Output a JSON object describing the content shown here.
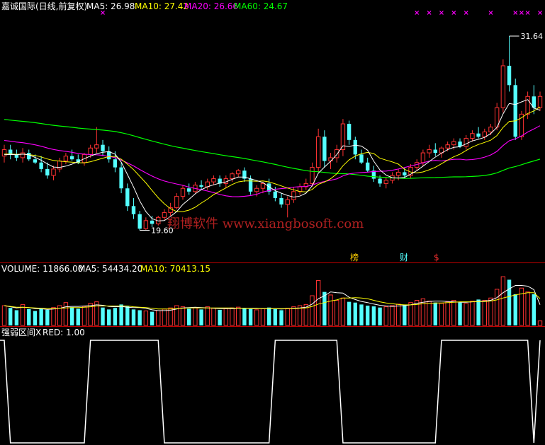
{
  "main_header": {
    "title": "嘉诚国际(日线,前复权)",
    "ma5": "MA5: 26.98",
    "ma10": "MA10: 27.42",
    "ma20": "MA20: 26.66",
    "ma60": "MA60: 24.67"
  },
  "volume_header": {
    "volume": "VOLUME: 11866.00",
    "ma5": "MA5: 54434.20",
    "ma10": "MA10: 70413.15"
  },
  "indicator_header": {
    "label": "强弱区间X",
    "red": "RED: 1.00"
  },
  "markers": {
    "bang": "榜",
    "cai": "财",
    "dollar": "$"
  },
  "watermark": "翔博软件 www.xiangbosoft.com",
  "colors": {
    "background": "#000000",
    "up": "#ff3232",
    "down": "#54ffff",
    "ma5": "#ffffff",
    "ma10": "#ffff00",
    "ma20": "#ff00ff",
    "ma60": "#00ff00",
    "separator": "#c00000",
    "signal_marks": "#ff00ff"
  },
  "chart_data": [
    {
      "type": "candlestick",
      "ylim": [
        18.0,
        33.0
      ],
      "annotations": [
        {
          "text": "31.64",
          "label": "high"
        },
        {
          "text": "19.60",
          "label": "low"
        }
      ],
      "candles": [
        [
          24.2,
          24.9,
          23.8,
          24.6
        ],
        [
          24.6,
          24.9,
          24.0,
          24.3
        ],
        [
          24.3,
          24.6,
          23.9,
          24.1
        ],
        [
          24.1,
          24.7,
          23.8,
          24.4
        ],
        [
          24.4,
          24.6,
          23.9,
          24.0
        ],
        [
          24.0,
          24.3,
          23.7,
          23.8
        ],
        [
          23.8,
          24.2,
          23.2,
          23.4
        ],
        [
          23.4,
          23.8,
          22.8,
          23.0
        ],
        [
          23.0,
          23.6,
          22.7,
          23.4
        ],
        [
          23.4,
          24.1,
          23.2,
          23.9
        ],
        [
          23.9,
          24.4,
          23.7,
          24.2
        ],
        [
          24.2,
          24.6,
          23.9,
          24.0
        ],
        [
          24.0,
          24.3,
          23.7,
          23.8
        ],
        [
          23.8,
          24.4,
          23.6,
          24.3
        ],
        [
          24.3,
          24.9,
          24.1,
          24.7
        ],
        [
          24.7,
          26.0,
          24.4,
          24.9
        ],
        [
          24.9,
          25.2,
          24.2,
          24.5
        ],
        [
          24.5,
          24.8,
          23.8,
          24.0
        ],
        [
          24.0,
          24.5,
          23.2,
          23.5
        ],
        [
          23.5,
          23.8,
          21.9,
          22.2
        ],
        [
          22.2,
          22.5,
          20.8,
          21.1
        ],
        [
          21.1,
          21.6,
          20.3,
          20.6
        ],
        [
          20.6,
          20.8,
          19.6,
          19.7
        ],
        [
          19.7,
          20.4,
          19.6,
          20.2
        ],
        [
          20.2,
          20.5,
          19.8,
          20.0
        ],
        [
          20.0,
          20.5,
          19.9,
          20.4
        ],
        [
          20.4,
          20.9,
          20.2,
          20.7
        ],
        [
          20.7,
          21.3,
          20.5,
          21.0
        ],
        [
          21.0,
          21.9,
          20.9,
          21.7
        ],
        [
          21.7,
          22.4,
          21.5,
          22.2
        ],
        [
          22.2,
          22.5,
          21.8,
          22.0
        ],
        [
          22.0,
          22.6,
          21.9,
          22.4
        ],
        [
          22.4,
          22.7,
          22.1,
          22.3
        ],
        [
          22.3,
          22.8,
          22.1,
          22.6
        ],
        [
          22.6,
          23.0,
          22.4,
          22.8
        ],
        [
          22.8,
          23.0,
          22.3,
          22.5
        ],
        [
          22.5,
          23.0,
          22.2,
          22.8
        ],
        [
          22.8,
          23.2,
          22.6,
          23.1
        ],
        [
          23.1,
          23.4,
          22.9,
          23.3
        ],
        [
          23.3,
          23.5,
          22.6,
          22.8
        ],
        [
          22.8,
          23.0,
          21.8,
          22.0
        ],
        [
          22.0,
          22.4,
          21.7,
          22.2
        ],
        [
          22.2,
          22.6,
          21.9,
          22.5
        ],
        [
          22.5,
          22.8,
          21.8,
          22.0
        ],
        [
          22.0,
          22.3,
          21.4,
          21.6
        ],
        [
          21.6,
          21.9,
          21.0,
          21.2
        ],
        [
          21.2,
          21.7,
          20.4,
          21.5
        ],
        [
          21.5,
          22.3,
          21.3,
          22.0
        ],
        [
          22.0,
          22.5,
          21.8,
          22.3
        ],
        [
          22.3,
          22.8,
          22.1,
          22.5
        ],
        [
          22.5,
          23.8,
          22.3,
          23.5
        ],
        [
          23.5,
          25.9,
          23.2,
          25.4
        ],
        [
          25.4,
          25.8,
          23.5,
          23.9
        ],
        [
          23.9,
          24.4,
          23.4,
          24.1
        ],
        [
          24.1,
          24.9,
          23.8,
          24.6
        ],
        [
          24.6,
          26.5,
          24.2,
          26.2
        ],
        [
          26.2,
          26.4,
          24.9,
          25.2
        ],
        [
          25.2,
          25.4,
          24.0,
          24.3
        ],
        [
          24.3,
          24.6,
          23.7,
          23.8
        ],
        [
          23.8,
          24.1,
          23.2,
          23.3
        ],
        [
          23.3,
          23.6,
          22.6,
          22.8
        ],
        [
          22.8,
          23.0,
          22.3,
          22.5
        ],
        [
          22.5,
          22.9,
          22.2,
          22.7
        ],
        [
          22.7,
          23.2,
          22.5,
          23.0
        ],
        [
          23.0,
          23.4,
          22.7,
          23.2
        ],
        [
          23.2,
          23.5,
          22.8,
          23.0
        ],
        [
          23.0,
          23.7,
          22.8,
          23.5
        ],
        [
          23.5,
          24.0,
          23.3,
          23.8
        ],
        [
          23.8,
          24.6,
          23.6,
          24.4
        ],
        [
          24.4,
          24.9,
          24.1,
          24.6
        ],
        [
          24.6,
          25.0,
          24.2,
          24.4
        ],
        [
          24.4,
          24.8,
          24.1,
          24.7
        ],
        [
          24.7,
          25.1,
          24.5,
          24.9
        ],
        [
          24.9,
          25.3,
          24.6,
          25.1
        ],
        [
          25.1,
          25.3,
          24.7,
          24.8
        ],
        [
          24.8,
          25.5,
          24.6,
          25.3
        ],
        [
          25.3,
          25.8,
          25.1,
          25.6
        ],
        [
          25.6,
          26.0,
          25.3,
          25.4
        ],
        [
          25.4,
          25.9,
          25.2,
          25.7
        ],
        [
          25.7,
          26.2,
          25.5,
          26.0
        ],
        [
          26.0,
          27.5,
          25.8,
          27.2
        ],
        [
          27.2,
          30.2,
          26.9,
          29.8
        ],
        [
          29.8,
          31.64,
          28.2,
          28.6
        ],
        [
          28.6,
          29.0,
          25.2,
          25.4
        ],
        [
          25.4,
          27.0,
          25.2,
          26.8
        ],
        [
          26.8,
          28.2,
          26.5,
          27.9
        ],
        [
          27.9,
          28.6,
          26.8,
          27.2
        ],
        [
          27.2,
          28.2,
          27.0,
          27.9
        ]
      ]
    },
    {
      "type": "bar",
      "series": [
        {
          "name": "VOLUME",
          "values": [
            52000,
            46000,
            40000,
            55000,
            43000,
            38000,
            45000,
            41000,
            47000,
            52000,
            60000,
            48000,
            44000,
            50000,
            58000,
            62000,
            47000,
            42000,
            46000,
            55000,
            50000,
            42000,
            40000,
            38000,
            36000,
            39000,
            43000,
            46000,
            52000,
            49000,
            44000,
            47000,
            42000,
            49000,
            45000,
            41000,
            44000,
            46000,
            48000,
            45000,
            43000,
            41000,
            44000,
            47000,
            43000,
            40000,
            45000,
            49000,
            52000,
            55000,
            78000,
            118000,
            88000,
            80000,
            66000,
            72000,
            62000,
            60000,
            55000,
            52000,
            50000,
            47000,
            49000,
            52000,
            56000,
            54000,
            60000,
            66000,
            70000,
            64000,
            60000,
            58000,
            62000,
            66000,
            60000,
            58000,
            64000,
            68000,
            66000,
            72000,
            95000,
            128000,
            120000,
            82000,
            98000,
            88000,
            82000,
            11866
          ]
        },
        {
          "name": "MA5",
          "values": [
            52000,
            49000,
            46000,
            48000,
            47000,
            44000,
            44000,
            42000,
            43000,
            45000,
            49000,
            50000,
            50000,
            51000,
            52000,
            54000,
            53000,
            50000,
            49000,
            50000,
            48000,
            47000,
            47000,
            45000,
            41000,
            39000,
            39000,
            40000,
            43000,
            46000,
            47000,
            48000,
            47000,
            46000,
            45000,
            44000,
            44000,
            44000,
            45000,
            45000,
            45000,
            45000,
            44000,
            44000,
            44000,
            43000,
            44000,
            45000,
            46000,
            48000,
            56000,
            70000,
            78000,
            88000,
            86000,
            85000,
            74000,
            68000,
            63000,
            60000,
            56000,
            53000,
            51000,
            50000,
            51000,
            52000,
            54000,
            58000,
            61000,
            63000,
            64000,
            64000,
            63000,
            62000,
            61000,
            61000,
            62000,
            64000,
            64000,
            66000,
            73000,
            86000,
            96000,
            105000,
            105000,
            103000,
            94000,
            54434
          ]
        },
        {
          "name": "MA10",
          "values": [
            52000,
            50000,
            48000,
            48000,
            47000,
            46000,
            45000,
            44000,
            44000,
            45000,
            46000,
            47000,
            47000,
            48000,
            49000,
            51000,
            51000,
            51000,
            51000,
            51000,
            51000,
            49000,
            48000,
            47000,
            45000,
            43000,
            43000,
            43000,
            44000,
            45000,
            46000,
            46000,
            46000,
            46000,
            46000,
            46000,
            46000,
            46000,
            45000,
            45000,
            44000,
            44000,
            44000,
            44000,
            44000,
            44000,
            44000,
            44000,
            45000,
            46000,
            50000,
            56000,
            60000,
            64000,
            67000,
            72000,
            72000,
            73000,
            72000,
            70000,
            66000,
            62000,
            59000,
            57000,
            55000,
            54000,
            54000,
            55000,
            57000,
            58000,
            59000,
            59000,
            60000,
            61000,
            62000,
            62000,
            62000,
            63000,
            63000,
            64000,
            67000,
            72000,
            76000,
            80000,
            83000,
            86000,
            86000,
            70413
          ]
        }
      ]
    },
    {
      "type": "line",
      "series": [
        {
          "name": "强弱区间X",
          "values": [
            1,
            0,
            0,
            0,
            0,
            0,
            0,
            0,
            0,
            0,
            0,
            0,
            0,
            0,
            1,
            1,
            1,
            1,
            1,
            1,
            1,
            1,
            1,
            1,
            1,
            1,
            0,
            0,
            0,
            0,
            0,
            0,
            0,
            0,
            0,
            0,
            0,
            0,
            0,
            0,
            0,
            0,
            0,
            0,
            1,
            1,
            1,
            1,
            1,
            1,
            1,
            1,
            1,
            1,
            1,
            0,
            0,
            0,
            0,
            0,
            0,
            0,
            0,
            0,
            0,
            0,
            0,
            0,
            0,
            0,
            0,
            1,
            1,
            1,
            1,
            1,
            1,
            1,
            1,
            1,
            1,
            1,
            1,
            1,
            1,
            1,
            0,
            1
          ]
        }
      ]
    }
  ]
}
